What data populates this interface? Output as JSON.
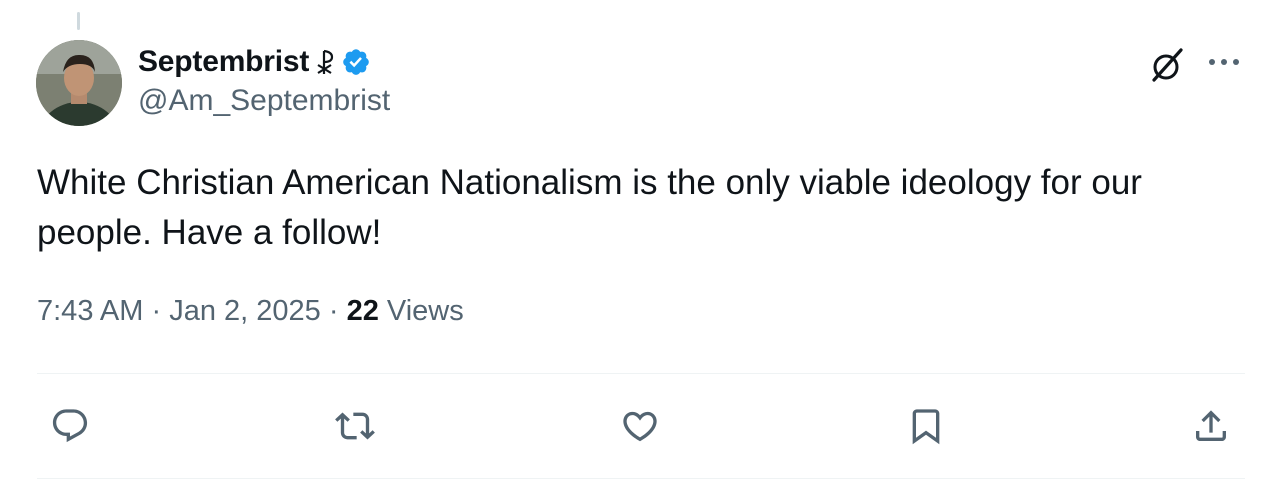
{
  "tweet": {
    "author": {
      "display_name": "Septembrist",
      "name_emoji": "chi-rho-icon",
      "verified": true,
      "handle": "@Am_Septembrist"
    },
    "text": "White Christian American Nationalism is the only viable ideology for our people. Have a follow!",
    "time": "7:43 AM",
    "separator": "·",
    "date": "Jan 2, 2025",
    "views_count": "22",
    "views_label": "Views"
  },
  "actions": [
    {
      "name": "reply",
      "icon": "reply-icon"
    },
    {
      "name": "repost",
      "icon": "repost-icon"
    },
    {
      "name": "like",
      "icon": "heart-icon"
    },
    {
      "name": "bookmark",
      "icon": "bookmark-icon"
    },
    {
      "name": "share",
      "icon": "share-icon"
    }
  ],
  "colors": {
    "text": "#0f1419",
    "secondary": "#536471",
    "verified": "#1d9bf0",
    "divider": "#eff3f4"
  }
}
